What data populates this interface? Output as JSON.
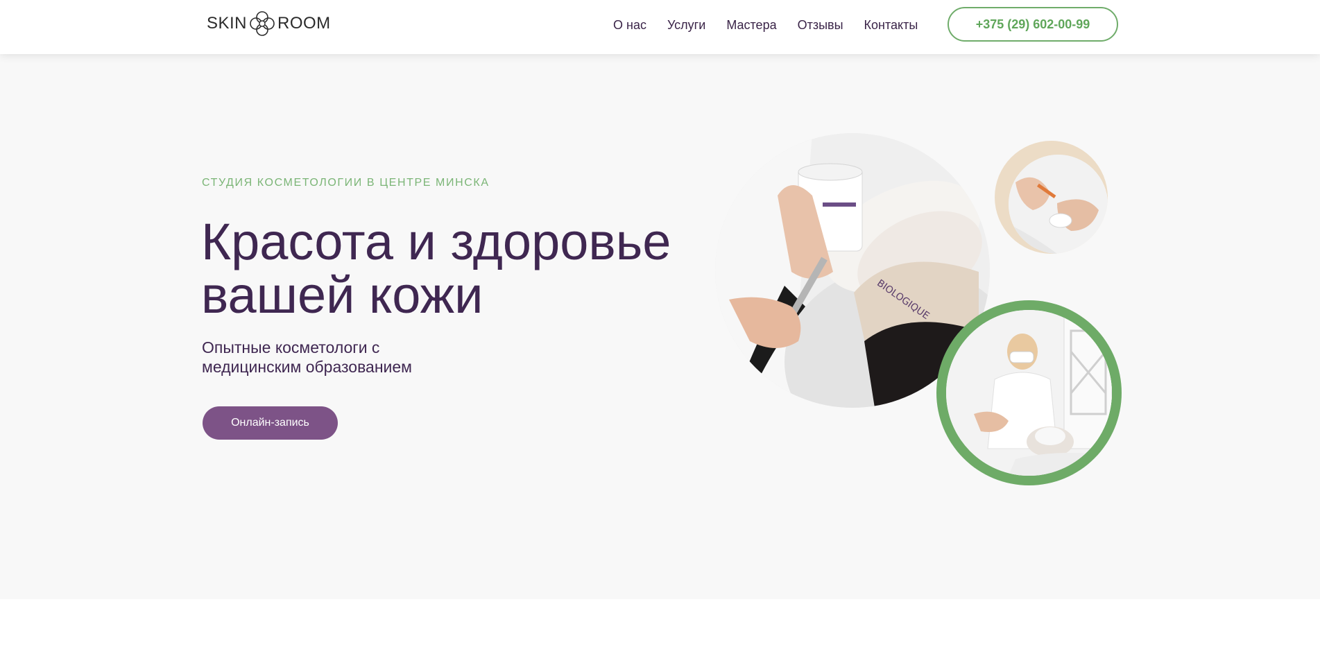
{
  "header": {
    "logo_left": "SKIN",
    "logo_right": "ROOM",
    "nav": [
      {
        "label": "О нас"
      },
      {
        "label": "Услуги"
      },
      {
        "label": "Мастера"
      },
      {
        "label": "Отзывы"
      },
      {
        "label": "Контакты"
      }
    ],
    "phone": "+375 (29) 602-00-99"
  },
  "hero": {
    "eyebrow": "СТУДИЯ КОСМЕТОЛОГИИ В ЦЕНТРЕ МИНСКА",
    "title_line1": "Красота и здоровье",
    "title_line2": "вашей кожи",
    "lead_line1": "Опытные косметологи с",
    "lead_line2": "медицинским образованием",
    "cta_label": "Онлайн-запись"
  },
  "images": {
    "big": "facial-mask-treatment-photo",
    "small": "cosmetologist-hands-photo",
    "green": "cosmetologist-with-client-photo"
  },
  "colors": {
    "brand_purple": "#3f2751",
    "button_purple": "#7d5387",
    "accent_green": "#6eab67",
    "hero_bg": "#f8f8f8"
  }
}
